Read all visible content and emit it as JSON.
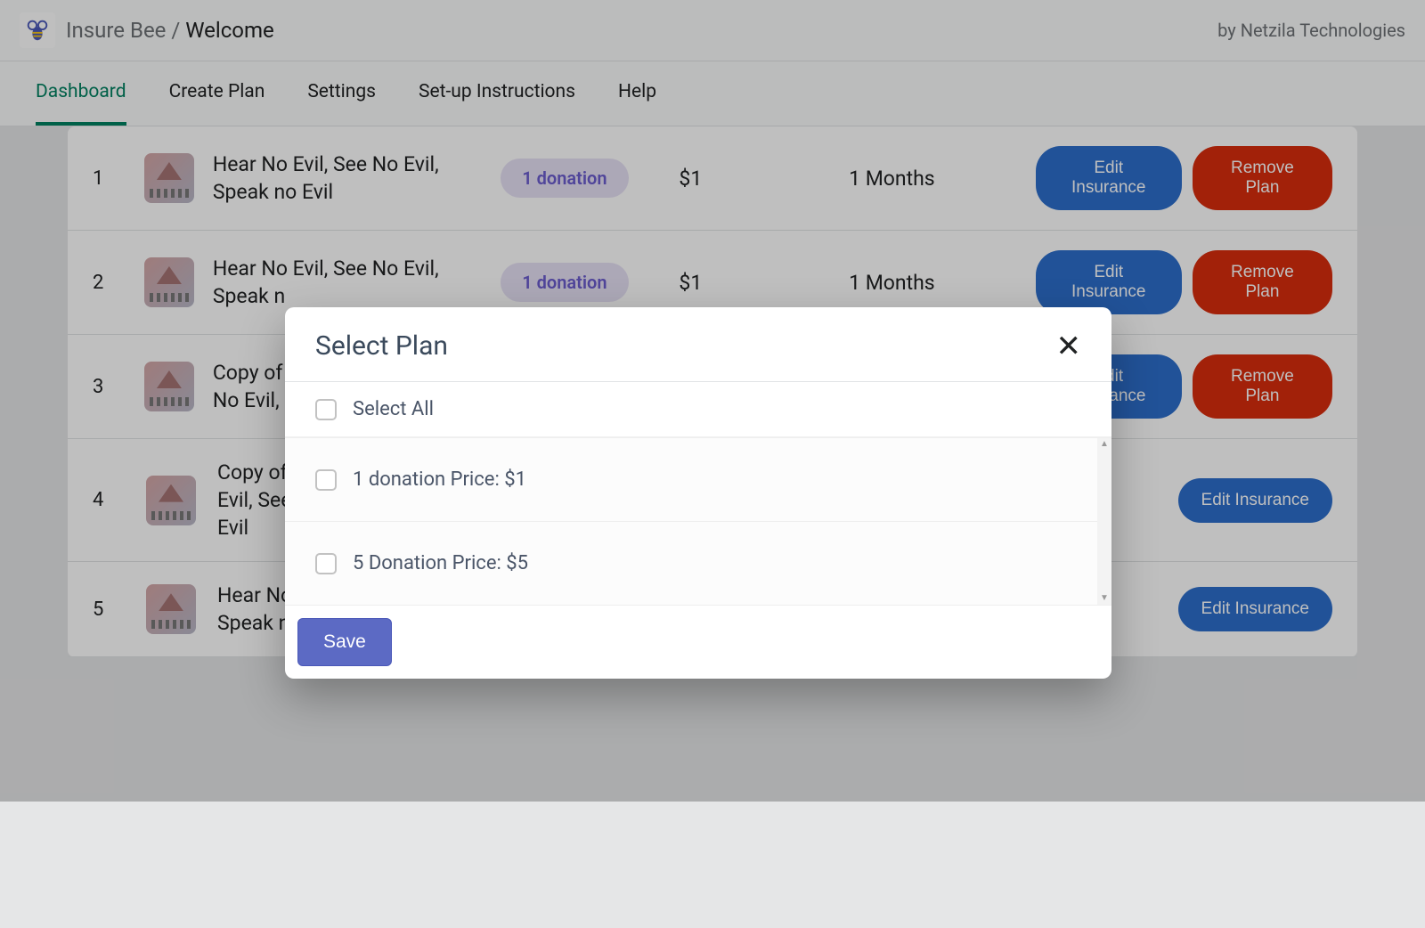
{
  "header": {
    "brand": "Insure Bee",
    "breadcrumb_separator": " / ",
    "current": "Welcome",
    "by": "by Netzila Technologies"
  },
  "tabs": [
    {
      "label": "Dashboard",
      "active": true
    },
    {
      "label": "Create Plan",
      "active": false
    },
    {
      "label": "Settings",
      "active": false
    },
    {
      "label": "Set-up Instructions",
      "active": false
    },
    {
      "label": "Help",
      "active": false
    }
  ],
  "rows": [
    {
      "num": "1",
      "title": "Hear No Evil, See No Evil, Speak no Evil",
      "badge": "1 donation",
      "price": "$1",
      "months": "1 Months",
      "edit": "Edit Insurance",
      "remove": "Remove Plan"
    },
    {
      "num": "2",
      "title": "Hear No Evil, See No Evil, Speak n",
      "badge": "1 donation",
      "price": "$1",
      "months": "1 Months",
      "edit": "Edit Insurance",
      "remove": "Remove Plan"
    },
    {
      "num": "3",
      "title": "Copy of\nNo Evil,",
      "badge": "",
      "price": "",
      "months": "",
      "edit": "Edit Insurance",
      "remove": "Remove Plan"
    },
    {
      "num": "4",
      "title": "Copy of\nEvil, See\nEvil",
      "badge": "",
      "price": "",
      "months": "",
      "edit": "Edit Insurance",
      "remove": ""
    },
    {
      "num": "5",
      "title": "Hear No\nSpeak n",
      "badge": "",
      "price": "",
      "months": "",
      "edit": "Edit Insurance",
      "remove": ""
    }
  ],
  "modal": {
    "title": "Select Plan",
    "select_all": "Select All",
    "options": [
      "1 donation  Price: $1",
      "5 Donation  Price: $5"
    ],
    "save": "Save"
  }
}
